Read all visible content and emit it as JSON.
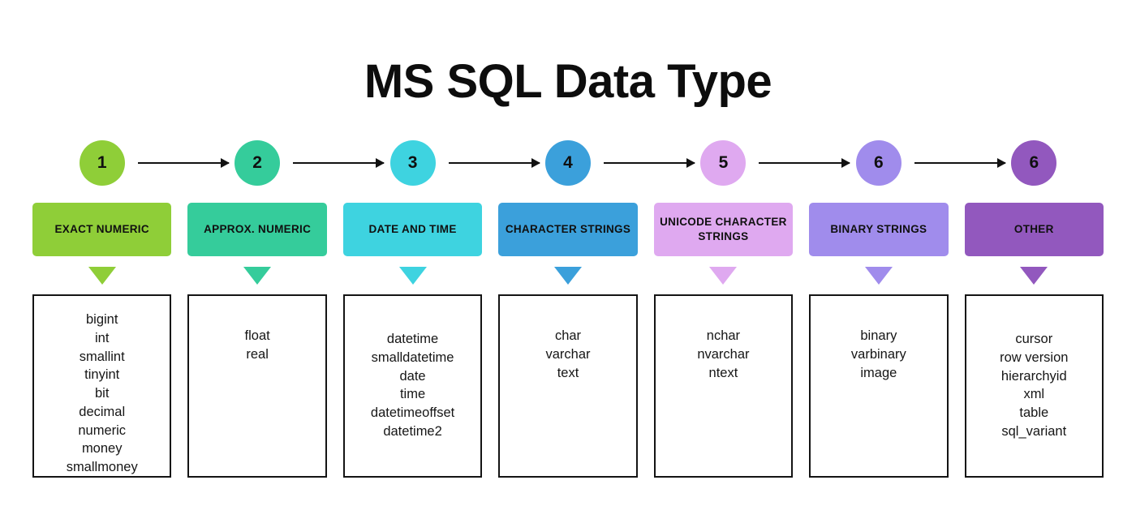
{
  "title": "MS SQL Data Type",
  "background_color": "#ffffff",
  "columns": [
    {
      "step": "1",
      "label": "EXACT NUMERIC",
      "color": "#8FCE38",
      "circle_color": "#8FCE38",
      "triangle_color": "#8FCE38",
      "has_arrow": true,
      "types": [
        "bigint",
        "int",
        "smallint",
        "tinyint",
        "bit",
        "decimal",
        "numeric",
        "money",
        "smallmoney"
      ]
    },
    {
      "step": "2",
      "label": "APPROX. NUMERIC",
      "color": "#35CC9B",
      "circle_color": "#35CC9B",
      "triangle_color": "#35CC9B",
      "has_arrow": true,
      "types": [
        "float",
        "real"
      ]
    },
    {
      "step": "3",
      "label": "DATE AND TIME",
      "color": "#3ED3E0",
      "circle_color": "#3ED3E0",
      "triangle_color": "#3ED3E0",
      "has_arrow": true,
      "types": [
        "datetime",
        "smalldatetime",
        "date",
        "time",
        "datetimeoffset",
        "datetime2"
      ]
    },
    {
      "step": "4",
      "label": "CHARACTER STRINGS",
      "color": "#3BA0DB",
      "circle_color": "#3BA0DB",
      "triangle_color": "#3BA0DB",
      "has_arrow": true,
      "types": [
        "char",
        "varchar",
        "text"
      ]
    },
    {
      "step": "5",
      "label": "UNICODE CHARACTER STRINGS",
      "color": "#DFA9F0",
      "circle_color": "#DFA9F0",
      "triangle_color": "#DFA9F0",
      "has_arrow": true,
      "types": [
        "nchar",
        "nvarchar",
        "ntext"
      ]
    },
    {
      "step": "6",
      "label": "BINARY STRINGS",
      "color": "#A08CEC",
      "circle_color": "#A08CEC",
      "triangle_color": "#A08CEC",
      "has_arrow": true,
      "types": [
        "binary",
        "varbinary",
        "image"
      ]
    },
    {
      "step": "6",
      "label": "OTHER",
      "color": "#9258BE",
      "circle_color": "#9258BE",
      "triangle_color": "#9258BE",
      "has_arrow": false,
      "types": [
        "cursor",
        "row version",
        "hierarchyid",
        "xml",
        "table",
        "sql_variant"
      ]
    }
  ]
}
